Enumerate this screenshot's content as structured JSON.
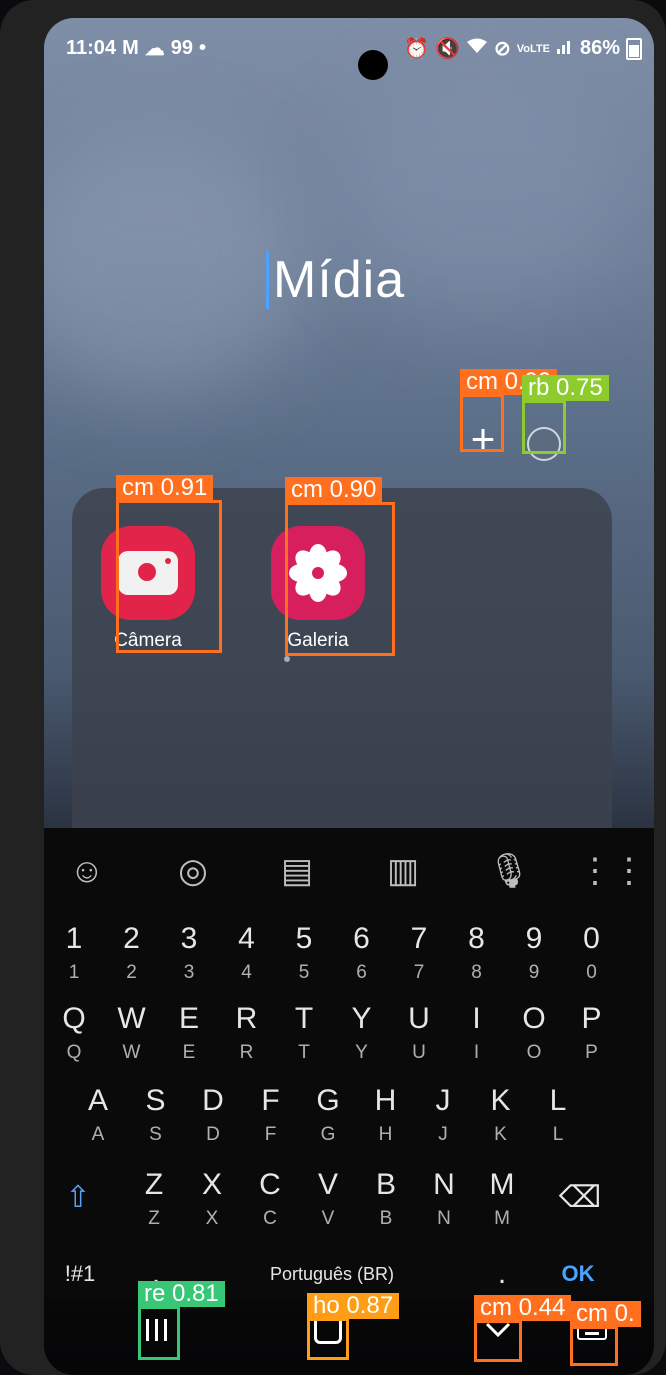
{
  "status_bar": {
    "time": "11:04",
    "left_icons": [
      "gmail-icon",
      "cloud-icon"
    ],
    "notification_count": "99",
    "battery": "86%",
    "right_icons": [
      "alarm-icon",
      "mute-icon",
      "wifi-icon",
      "no-disturb-icon",
      "volte-icon",
      "signal-icon"
    ]
  },
  "folder": {
    "title": "Mídia",
    "add_symbol": "+",
    "apps": [
      {
        "label": "Câmera",
        "icon": "camera-icon",
        "color": "#e3244a"
      },
      {
        "label": "Galeria",
        "icon": "gallery-flower-icon",
        "color": "#d81f5d"
      }
    ]
  },
  "keyboard": {
    "toolbar_icons": [
      "emoji-icon",
      "sticker-icon",
      "clipboard-icon",
      "one-hand-icon",
      "mic-icon",
      "grid-icon"
    ],
    "number_row": [
      "1",
      "2",
      "3",
      "4",
      "5",
      "6",
      "7",
      "8",
      "9",
      "0"
    ],
    "row1": [
      "Q",
      "W",
      "E",
      "R",
      "T",
      "Y",
      "U",
      "I",
      "O",
      "P"
    ],
    "row2": [
      "A",
      "S",
      "D",
      "F",
      "G",
      "H",
      "J",
      "K",
      "L"
    ],
    "row3": [
      "Z",
      "X",
      "C",
      "V",
      "B",
      "N",
      "M"
    ],
    "symbols_key": "!#1",
    "comma_key": ",",
    "space_label": "Português (BR)",
    "period_key": ".",
    "ok_key": "OK"
  },
  "navbar": {
    "icons": [
      "recents-icon",
      "home-icon",
      "back-chevron-icon",
      "keyboard-switch-icon"
    ]
  },
  "detections": [
    {
      "label": "cm 0.91",
      "color": "#ff6f1e"
    },
    {
      "label": "cm 0.90",
      "color": "#ff6f1e"
    },
    {
      "label": "cm 0.99",
      "color": "#ff6f1e"
    },
    {
      "label": "rb 0.75",
      "color": "#8ecb2d"
    },
    {
      "label": "re 0.81",
      "color": "#37c777"
    },
    {
      "label": "ho 0.87",
      "color": "#ff9d17"
    },
    {
      "label": "cm 0.44",
      "color": "#ff6f1e"
    },
    {
      "label": "cm 0.",
      "color": "#ff6f1e"
    }
  ]
}
